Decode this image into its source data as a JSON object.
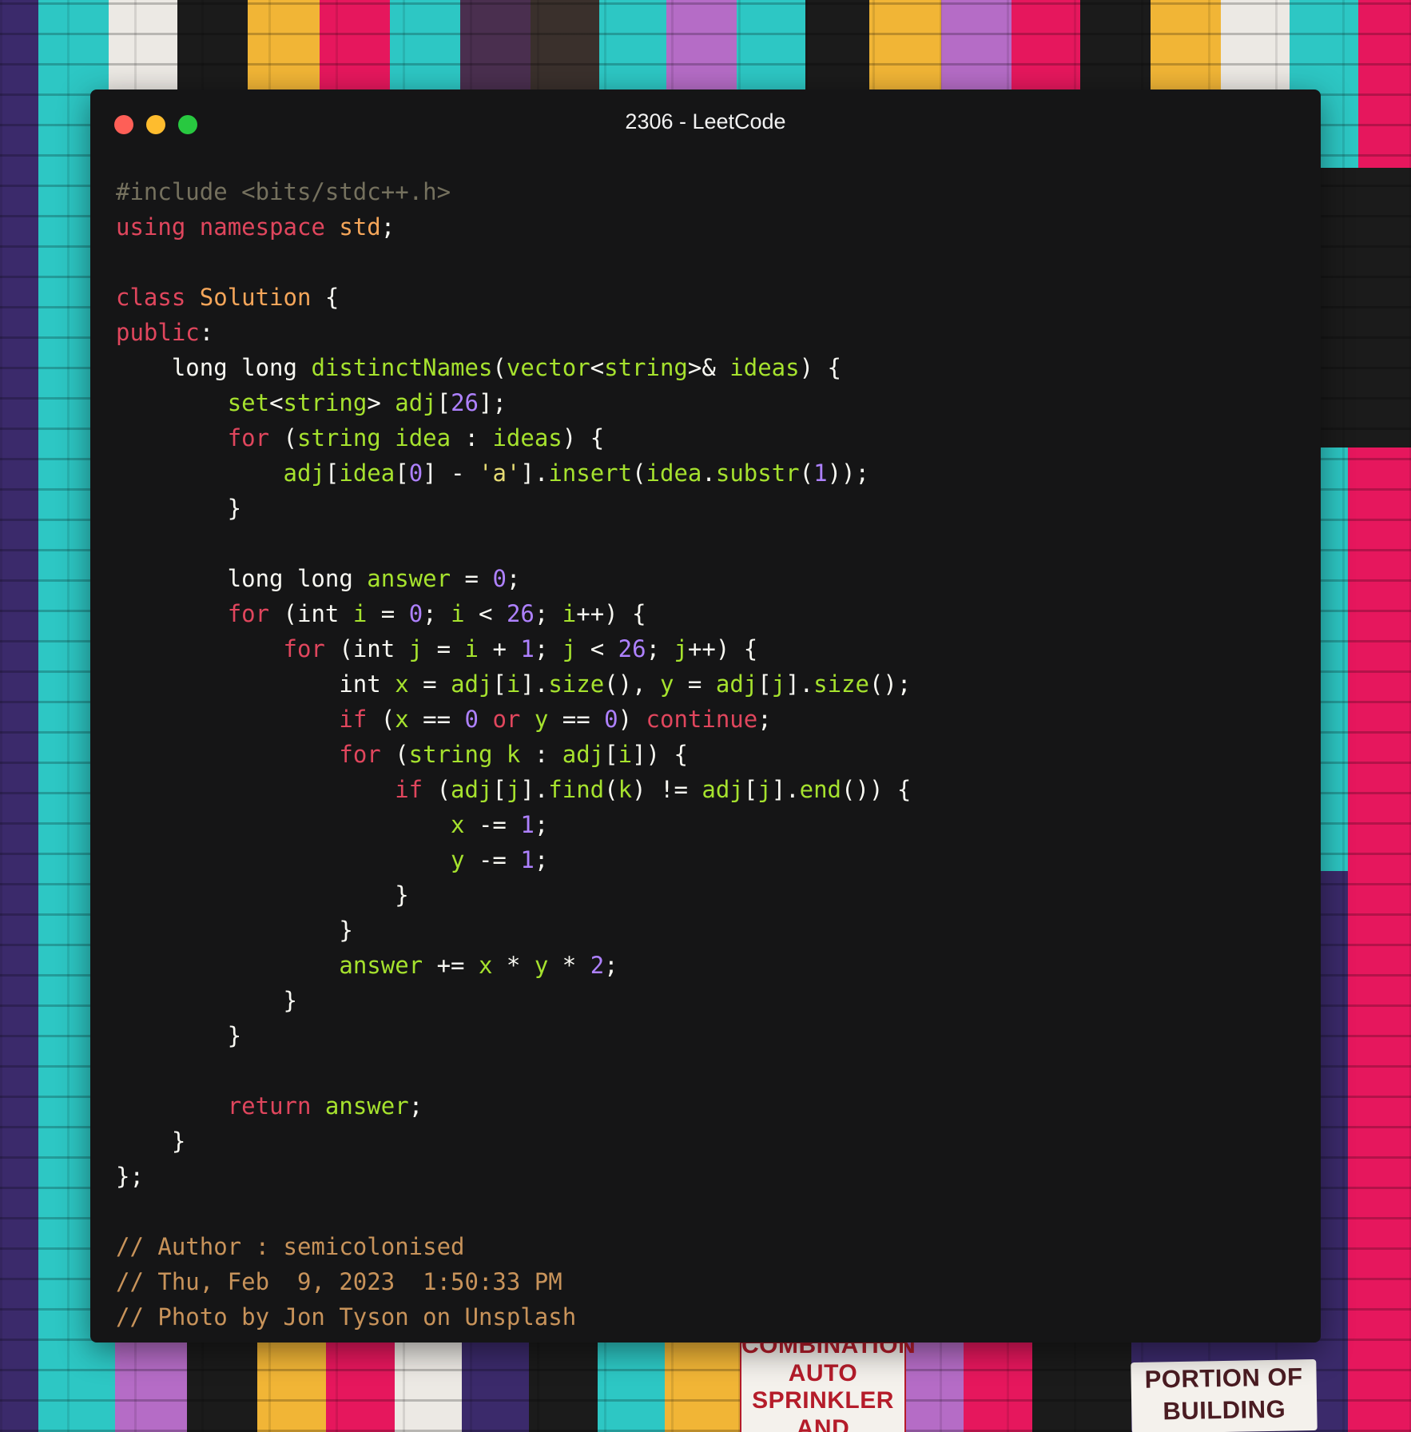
{
  "window": {
    "title": "2306 - LeetCode",
    "traffic_lights": [
      "close",
      "minimize",
      "zoom"
    ],
    "colors": {
      "background": "#151516",
      "close": "#fe5f57",
      "minimize": "#febc2e",
      "zoom": "#28c840"
    }
  },
  "code": {
    "language": "cpp",
    "lines": [
      [
        {
          "t": "pre",
          "v": "#include <bits/stdc++.h>"
        }
      ],
      [
        {
          "t": "kw",
          "v": "using"
        },
        {
          "t": "txt",
          "v": " "
        },
        {
          "t": "kw",
          "v": "namespace"
        },
        {
          "t": "txt",
          "v": " "
        },
        {
          "t": "cls",
          "v": "std"
        },
        {
          "t": "txt",
          "v": ";"
        }
      ],
      [],
      [
        {
          "t": "kw",
          "v": "class"
        },
        {
          "t": "txt",
          "v": " "
        },
        {
          "t": "cls",
          "v": "Solution"
        },
        {
          "t": "txt",
          "v": " {"
        }
      ],
      [
        {
          "t": "kw",
          "v": "public"
        },
        {
          "t": "txt",
          "v": ":"
        }
      ],
      [
        {
          "t": "txt",
          "v": "    long long "
        },
        {
          "t": "fn",
          "v": "distinctNames"
        },
        {
          "t": "txt",
          "v": "("
        },
        {
          "t": "id",
          "v": "vector"
        },
        {
          "t": "txt",
          "v": "<"
        },
        {
          "t": "id",
          "v": "string"
        },
        {
          "t": "txt",
          "v": ">& "
        },
        {
          "t": "id",
          "v": "ideas"
        },
        {
          "t": "txt",
          "v": ") {"
        }
      ],
      [
        {
          "t": "txt",
          "v": "        "
        },
        {
          "t": "id",
          "v": "set"
        },
        {
          "t": "txt",
          "v": "<"
        },
        {
          "t": "id",
          "v": "string"
        },
        {
          "t": "txt",
          "v": "> "
        },
        {
          "t": "id",
          "v": "adj"
        },
        {
          "t": "txt",
          "v": "["
        },
        {
          "t": "num",
          "v": "26"
        },
        {
          "t": "txt",
          "v": "];"
        }
      ],
      [
        {
          "t": "txt",
          "v": "        "
        },
        {
          "t": "kw",
          "v": "for"
        },
        {
          "t": "txt",
          "v": " ("
        },
        {
          "t": "id",
          "v": "string"
        },
        {
          "t": "txt",
          "v": " "
        },
        {
          "t": "id",
          "v": "idea"
        },
        {
          "t": "txt",
          "v": " : "
        },
        {
          "t": "id",
          "v": "ideas"
        },
        {
          "t": "txt",
          "v": ") {"
        }
      ],
      [
        {
          "t": "txt",
          "v": "            "
        },
        {
          "t": "id",
          "v": "adj"
        },
        {
          "t": "txt",
          "v": "["
        },
        {
          "t": "id",
          "v": "idea"
        },
        {
          "t": "txt",
          "v": "["
        },
        {
          "t": "num",
          "v": "0"
        },
        {
          "t": "txt",
          "v": "] - "
        },
        {
          "t": "str",
          "v": "'a'"
        },
        {
          "t": "txt",
          "v": "]."
        },
        {
          "t": "fn",
          "v": "insert"
        },
        {
          "t": "txt",
          "v": "("
        },
        {
          "t": "id",
          "v": "idea"
        },
        {
          "t": "txt",
          "v": "."
        },
        {
          "t": "fn",
          "v": "substr"
        },
        {
          "t": "txt",
          "v": "("
        },
        {
          "t": "num",
          "v": "1"
        },
        {
          "t": "txt",
          "v": "));"
        }
      ],
      [
        {
          "t": "txt",
          "v": "        }"
        }
      ],
      [],
      [
        {
          "t": "txt",
          "v": "        long long "
        },
        {
          "t": "id",
          "v": "answer"
        },
        {
          "t": "txt",
          "v": " = "
        },
        {
          "t": "num",
          "v": "0"
        },
        {
          "t": "txt",
          "v": ";"
        }
      ],
      [
        {
          "t": "txt",
          "v": "        "
        },
        {
          "t": "kw",
          "v": "for"
        },
        {
          "t": "txt",
          "v": " (int "
        },
        {
          "t": "id",
          "v": "i"
        },
        {
          "t": "txt",
          "v": " = "
        },
        {
          "t": "num",
          "v": "0"
        },
        {
          "t": "txt",
          "v": "; "
        },
        {
          "t": "id",
          "v": "i"
        },
        {
          "t": "txt",
          "v": " < "
        },
        {
          "t": "num",
          "v": "26"
        },
        {
          "t": "txt",
          "v": "; "
        },
        {
          "t": "id",
          "v": "i"
        },
        {
          "t": "txt",
          "v": "++) {"
        }
      ],
      [
        {
          "t": "txt",
          "v": "            "
        },
        {
          "t": "kw",
          "v": "for"
        },
        {
          "t": "txt",
          "v": " (int "
        },
        {
          "t": "id",
          "v": "j"
        },
        {
          "t": "txt",
          "v": " = "
        },
        {
          "t": "id",
          "v": "i"
        },
        {
          "t": "txt",
          "v": " + "
        },
        {
          "t": "num",
          "v": "1"
        },
        {
          "t": "txt",
          "v": "; "
        },
        {
          "t": "id",
          "v": "j"
        },
        {
          "t": "txt",
          "v": " < "
        },
        {
          "t": "num",
          "v": "26"
        },
        {
          "t": "txt",
          "v": "; "
        },
        {
          "t": "id",
          "v": "j"
        },
        {
          "t": "txt",
          "v": "++) {"
        }
      ],
      [
        {
          "t": "txt",
          "v": "                int "
        },
        {
          "t": "id",
          "v": "x"
        },
        {
          "t": "txt",
          "v": " = "
        },
        {
          "t": "id",
          "v": "adj"
        },
        {
          "t": "txt",
          "v": "["
        },
        {
          "t": "id",
          "v": "i"
        },
        {
          "t": "txt",
          "v": "]."
        },
        {
          "t": "fn",
          "v": "size"
        },
        {
          "t": "txt",
          "v": "(), "
        },
        {
          "t": "id",
          "v": "y"
        },
        {
          "t": "txt",
          "v": " = "
        },
        {
          "t": "id",
          "v": "adj"
        },
        {
          "t": "txt",
          "v": "["
        },
        {
          "t": "id",
          "v": "j"
        },
        {
          "t": "txt",
          "v": "]."
        },
        {
          "t": "fn",
          "v": "size"
        },
        {
          "t": "txt",
          "v": "();"
        }
      ],
      [
        {
          "t": "txt",
          "v": "                "
        },
        {
          "t": "kw",
          "v": "if"
        },
        {
          "t": "txt",
          "v": " ("
        },
        {
          "t": "id",
          "v": "x"
        },
        {
          "t": "txt",
          "v": " == "
        },
        {
          "t": "num",
          "v": "0"
        },
        {
          "t": "txt",
          "v": " "
        },
        {
          "t": "kw",
          "v": "or"
        },
        {
          "t": "txt",
          "v": " "
        },
        {
          "t": "id",
          "v": "y"
        },
        {
          "t": "txt",
          "v": " == "
        },
        {
          "t": "num",
          "v": "0"
        },
        {
          "t": "txt",
          "v": ") "
        },
        {
          "t": "kw",
          "v": "continue"
        },
        {
          "t": "txt",
          "v": ";"
        }
      ],
      [
        {
          "t": "txt",
          "v": "                "
        },
        {
          "t": "kw",
          "v": "for"
        },
        {
          "t": "txt",
          "v": " ("
        },
        {
          "t": "id",
          "v": "string"
        },
        {
          "t": "txt",
          "v": " "
        },
        {
          "t": "id",
          "v": "k"
        },
        {
          "t": "txt",
          "v": " : "
        },
        {
          "t": "id",
          "v": "adj"
        },
        {
          "t": "txt",
          "v": "["
        },
        {
          "t": "id",
          "v": "i"
        },
        {
          "t": "txt",
          "v": "]) {"
        }
      ],
      [
        {
          "t": "txt",
          "v": "                    "
        },
        {
          "t": "kw",
          "v": "if"
        },
        {
          "t": "txt",
          "v": " ("
        },
        {
          "t": "id",
          "v": "adj"
        },
        {
          "t": "txt",
          "v": "["
        },
        {
          "t": "id",
          "v": "j"
        },
        {
          "t": "txt",
          "v": "]."
        },
        {
          "t": "fn",
          "v": "find"
        },
        {
          "t": "txt",
          "v": "("
        },
        {
          "t": "id",
          "v": "k"
        },
        {
          "t": "txt",
          "v": ") != "
        },
        {
          "t": "id",
          "v": "adj"
        },
        {
          "t": "txt",
          "v": "["
        },
        {
          "t": "id",
          "v": "j"
        },
        {
          "t": "txt",
          "v": "]."
        },
        {
          "t": "fn",
          "v": "end"
        },
        {
          "t": "txt",
          "v": "()) {"
        }
      ],
      [
        {
          "t": "txt",
          "v": "                        "
        },
        {
          "t": "id",
          "v": "x"
        },
        {
          "t": "txt",
          "v": " -= "
        },
        {
          "t": "num",
          "v": "1"
        },
        {
          "t": "txt",
          "v": ";"
        }
      ],
      [
        {
          "t": "txt",
          "v": "                        "
        },
        {
          "t": "id",
          "v": "y"
        },
        {
          "t": "txt",
          "v": " -= "
        },
        {
          "t": "num",
          "v": "1"
        },
        {
          "t": "txt",
          "v": ";"
        }
      ],
      [
        {
          "t": "txt",
          "v": "                    }"
        }
      ],
      [
        {
          "t": "txt",
          "v": "                }"
        }
      ],
      [
        {
          "t": "txt",
          "v": "                "
        },
        {
          "t": "id",
          "v": "answer"
        },
        {
          "t": "txt",
          "v": " += "
        },
        {
          "t": "id",
          "v": "x"
        },
        {
          "t": "txt",
          "v": " * "
        },
        {
          "t": "id",
          "v": "y"
        },
        {
          "t": "txt",
          "v": " * "
        },
        {
          "t": "num",
          "v": "2"
        },
        {
          "t": "txt",
          "v": ";"
        }
      ],
      [
        {
          "t": "txt",
          "v": "            }"
        }
      ],
      [
        {
          "t": "txt",
          "v": "        }"
        }
      ],
      [],
      [
        {
          "t": "txt",
          "v": "        "
        },
        {
          "t": "kw",
          "v": "return"
        },
        {
          "t": "txt",
          "v": " "
        },
        {
          "t": "id",
          "v": "answer"
        },
        {
          "t": "txt",
          "v": ";"
        }
      ],
      [
        {
          "t": "txt",
          "v": "    }"
        }
      ],
      [
        {
          "t": "txt",
          "v": "};"
        }
      ],
      [],
      [
        {
          "t": "cmt",
          "v": "// Author : semicolonised"
        }
      ],
      [
        {
          "t": "cmt",
          "v": "// Thu, Feb  9, 2023  1:50:33 PM"
        }
      ],
      [
        {
          "t": "cmt",
          "v": "// Photo by Jon Tyson on Unsplash"
        }
      ]
    ]
  },
  "background": {
    "sign_left": [
      "COMBINATION",
      "AUTO SPRINKLER",
      "AND STANDPIPE"
    ],
    "sign_right": [
      "PORTION OF",
      "BUILDING"
    ],
    "colors": [
      "#2dc7c4",
      "#e6175d",
      "#f1b536",
      "#b56cc6",
      "#3b2a6b",
      "#1b1b1b",
      "#ece9e4"
    ]
  }
}
